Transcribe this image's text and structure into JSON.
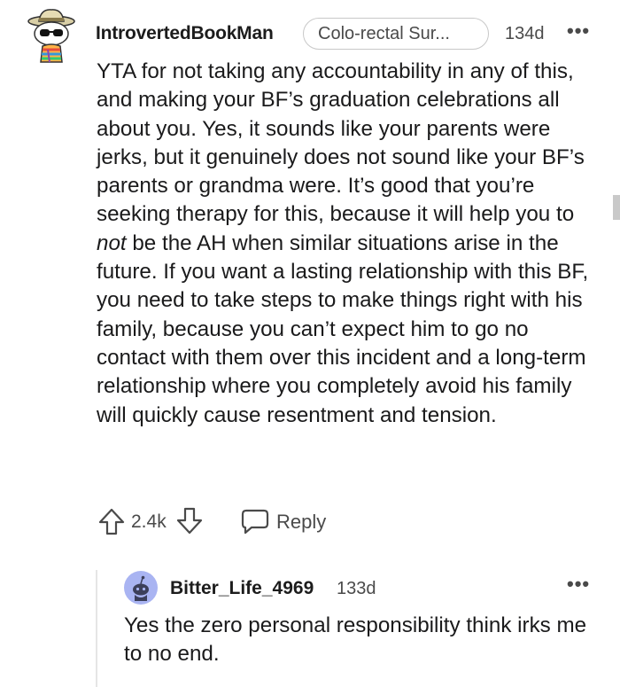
{
  "comment": {
    "username": "IntrovertedBookMan",
    "flair": "Colo-rectal Sur...",
    "age": "134d",
    "more": "•••",
    "body_part1": "YTA for not taking any accountability in any of this, and making your BF’s graduation celebrations all about you. Yes, it sounds like your parents were jerks, but it genuinely does not sound like your BF’s parents or grandma were. It’s good that you’re seeking therapy for this, because it will help you to ",
    "body_emphasis": "not",
    "body_part2": " be the AH when similar situations arise in the future. If you want a lasting relationship with this BF, you need to take steps to make things right with his family, because you can’t expect him to go no contact with them over this incident and a long-term relationship where you completely avoid his family will quickly cause resentment and tension.",
    "vote_count": "2.4k",
    "reply_label": "Reply",
    "icons": {
      "avatar": "snoo-avatar-hat-sunglasses",
      "upvote": "upvote-arrow-icon",
      "downvote": "downvote-arrow-icon",
      "reply": "speech-bubble-icon",
      "more": "ellipsis-icon"
    }
  },
  "reply": {
    "username": "Bitter_Life_4969",
    "age": "133d",
    "more": "•••",
    "body": "Yes the zero personal responsibility think irks me to no end.",
    "icons": {
      "avatar": "default-snoo-avatar"
    }
  },
  "colors": {
    "text": "#1a1a1b",
    "meta": "#4a4a4a",
    "avatar_reply_bg": "#a9b4f2",
    "thread_line": "#e5e5e5"
  }
}
